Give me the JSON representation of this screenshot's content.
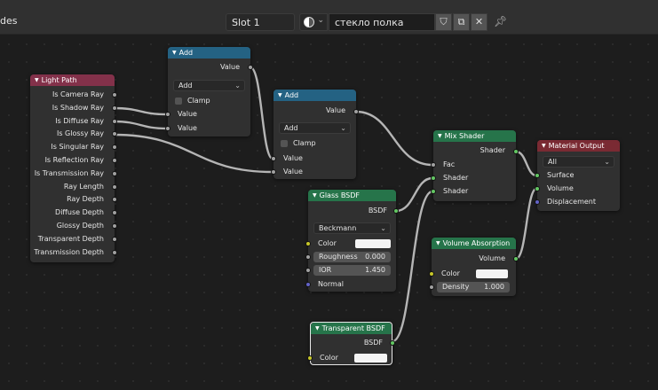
{
  "header": {
    "mode_label": "des",
    "slot": "Slot 1",
    "material_name": "стекло полка"
  },
  "nodes": {
    "light_path": {
      "title": "Light Path",
      "outputs": [
        "Is Camera Ray",
        "Is Shadow Ray",
        "Is Diffuse Ray",
        "Is Glossy Ray",
        "Is Singular Ray",
        "Is Reflection Ray",
        "Is Transmission Ray",
        "Ray Length",
        "Ray Depth",
        "Diffuse Depth",
        "Glossy Depth",
        "Transparent Depth",
        "Transmission Depth"
      ]
    },
    "add1": {
      "title": "Add",
      "output": "Value",
      "operation": "Add",
      "clamp": "Clamp",
      "inputs": [
        "Value",
        "Value"
      ]
    },
    "add2": {
      "title": "Add",
      "output": "Value",
      "operation": "Add",
      "clamp": "Clamp",
      "inputs": [
        "Value",
        "Value"
      ]
    },
    "glass": {
      "title": "Glass BSDF",
      "output": "BSDF",
      "distribution": "Beckmann",
      "color_label": "Color",
      "color": "#f4f4f4",
      "roughness_label": "Roughness",
      "roughness": "0.000",
      "ior_label": "IOR",
      "ior": "1.450",
      "normal_label": "Normal"
    },
    "mix": {
      "title": "Mix Shader",
      "output": "Shader",
      "fac": "Fac",
      "shader1": "Shader",
      "shader2": "Shader"
    },
    "volume": {
      "title": "Volume Absorption",
      "output": "Volume",
      "color_label": "Color",
      "color": "#f4f4f4",
      "density_label": "Density",
      "density": "1.000"
    },
    "transparent": {
      "title": "Transparent BSDF",
      "output": "BSDF",
      "color_label": "Color",
      "color": "#f4f4f4"
    },
    "output": {
      "title": "Material Output",
      "target": "All",
      "inputs": [
        "Surface",
        "Volume",
        "Displacement"
      ]
    }
  },
  "colors": {
    "input_header": "#83314a",
    "converter_header": "#246283",
    "shader_header": "#26744a",
    "output_header": "#7a2a33",
    "link": "#b5b5b5",
    "shader_link": "#63c763"
  }
}
